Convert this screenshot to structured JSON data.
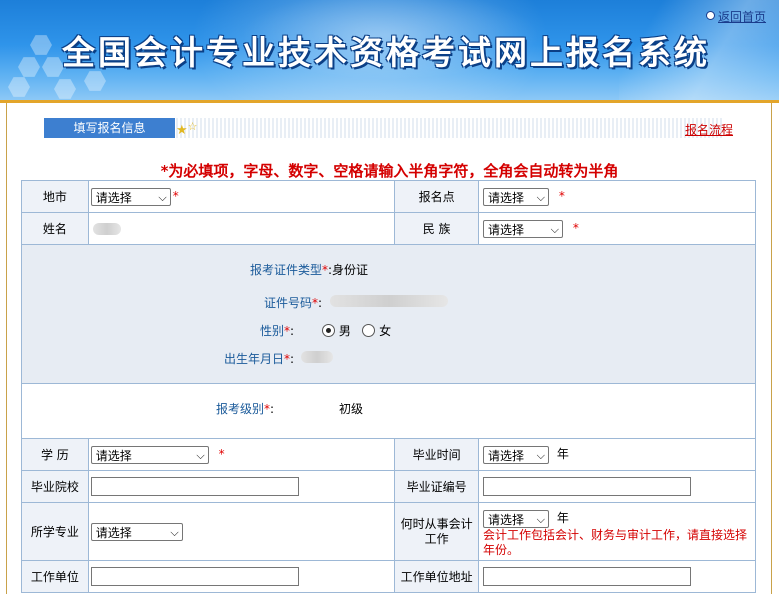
{
  "header": {
    "title": "全国会计专业技术资格考试网上报名系统",
    "home_link": "返回首页"
  },
  "tabs": {
    "active_tab": "填写报名信息",
    "flow_link": "报名流程"
  },
  "notice": "*为必填项，字母、数字、空格请输入半角字符，全角会自动转为半角",
  "form": {
    "region_label": "地市",
    "region_value": "请选择",
    "site_label": "报名点",
    "site_value": "请选择",
    "name_label": "姓名",
    "ethnicity_label": "民 族",
    "ethnicity_value": "请选择",
    "id_type_label": "报考证件类型",
    "id_type_value": "身份证",
    "id_number_label": "证件号码",
    "gender_label": "性别",
    "gender_options": [
      "男",
      "女"
    ],
    "gender_selected": "男",
    "birth_label": "出生年月日",
    "level_label": "报考级别",
    "level_value": "初级",
    "education_label": "学 历",
    "education_value": "请选择",
    "grad_time_label": "毕业时间",
    "grad_time_value": "请选择",
    "year_unit": "年",
    "school_label": "毕业院校",
    "cert_no_label": "毕业证编号",
    "major_label": "所学专业",
    "major_value": "请选择",
    "work_start_label": "何时从事会计工作",
    "work_start_value": "请选择",
    "work_note": "会计工作包括会计、财务与审计工作，请直接选择年份。",
    "employer_label": "工作单位",
    "employer_addr_label": "工作单位地址",
    "required_mark": "*",
    "colon": ":"
  },
  "colors": {
    "banner": "#2f94ea",
    "accent_gold": "#e3a52a",
    "required_red": "#e00000",
    "label_blue": "#1a5a9a",
    "tab_blue": "#3d7fd0"
  }
}
